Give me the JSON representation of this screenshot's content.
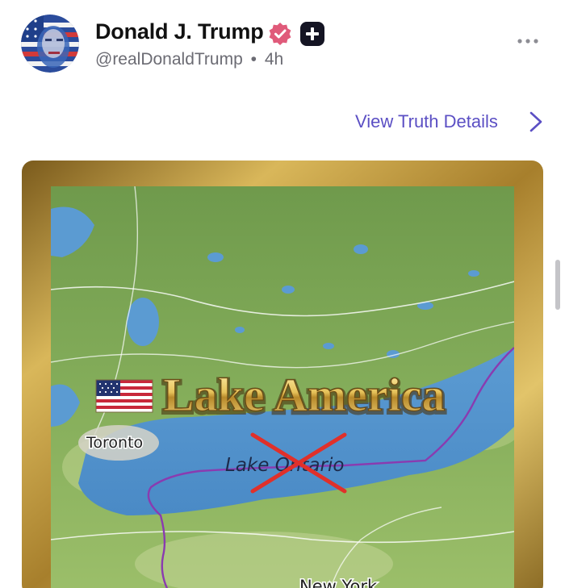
{
  "post": {
    "author": {
      "display_name": "Donald J. Trump",
      "handle": "@realDonaldTrump",
      "separator": "•",
      "time_ago": "4h"
    },
    "view_details_label": "View Truth Details",
    "more_icon": "more-horizontal-icon"
  },
  "media": {
    "title": "Lake America",
    "crossed_out_label": "Lake Ontario",
    "place_labels": {
      "city_left": "Toronto",
      "city_bottom": "New York"
    }
  },
  "colors": {
    "link": "#5b4fc4",
    "verified_badge": "#e05a7a",
    "strike_red": "#e0302a",
    "border_route": "#8a3bb0",
    "gold_frame": "#b8932f"
  }
}
